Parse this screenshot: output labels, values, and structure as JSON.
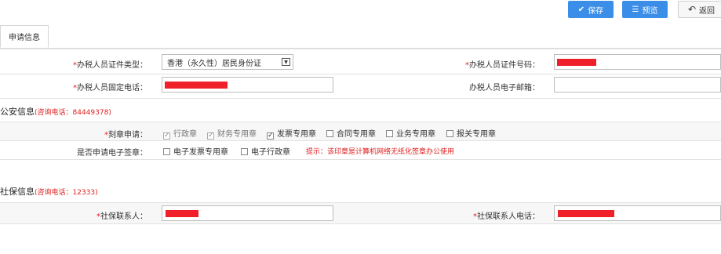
{
  "toolbar": {
    "save_label": "保存",
    "preview_label": "预览",
    "back_label": "返回"
  },
  "tabs": [
    "申请信息"
  ],
  "tax_person": {
    "cert_type_label": "办税人员证件类型：",
    "cert_type_value": "香港（永久性）居民身份证",
    "cert_no_label": "办税人员证件号码：",
    "phone_label": "办税人员固定电话：",
    "email_label": "办税人员电子邮箱："
  },
  "police": {
    "title": "公安信息",
    "hotline": "(咨询电话：84449378)",
    "seal_label": "刻章申请：",
    "seal_options": [
      {
        "label": "行政章",
        "checked": true,
        "disabled": true
      },
      {
        "label": "财务专用章",
        "checked": true,
        "disabled": true
      },
      {
        "label": "发票专用章",
        "checked": true,
        "disabled": false
      },
      {
        "label": "合同专用章",
        "checked": false,
        "disabled": false
      },
      {
        "label": "业务专用章",
        "checked": false,
        "disabled": false
      },
      {
        "label": "报关专用章",
        "checked": false,
        "disabled": false
      }
    ],
    "esign_label": "是否申请电子签章：",
    "esign_options": [
      {
        "label": "电子发票专用章",
        "checked": false
      },
      {
        "label": "电子行政章",
        "checked": false
      }
    ],
    "esign_hint": "提示：该印章是计算机网络无纸化签章办公使用"
  },
  "social": {
    "title": "社保信息",
    "hotline": "(咨询电话：12333)",
    "contact_label": "社保联系人：",
    "contact_phone_label": "社保联系人电话："
  },
  "colors": {
    "primary": "#3b8ee8",
    "required": "#e02020",
    "redacted": "#f0202a"
  }
}
